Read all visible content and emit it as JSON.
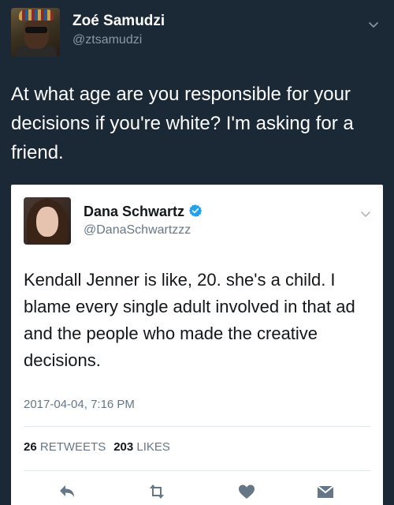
{
  "outer_tweet": {
    "name": "Zoé Samudzi",
    "handle": "@ztsamudzi",
    "text": "At what age are you responsible for your decisions if you're white? I'm asking for a friend."
  },
  "quoted_tweet": {
    "name": "Dana Schwartz",
    "verified": true,
    "handle": "@DanaSchwartzzz",
    "text": "Kendall Jenner is like, 20. she's a child. I blame every single adult involved in that ad and the people who made the creative decisions.",
    "timestamp": "2017-04-04, 7:16 PM",
    "retweets_count": "26",
    "retweets_label": "RETWEETS",
    "likes_count": "203",
    "likes_label": "LIKES"
  },
  "colors": {
    "background": "#1b2836",
    "secondary_text": "#8899a6",
    "verified_blue": "#1da1f2",
    "icon_gray": "#657786"
  },
  "icons": [
    "chevron-down-icon",
    "verified-icon",
    "reply-icon",
    "retweet-icon",
    "like-icon",
    "message-icon"
  ]
}
